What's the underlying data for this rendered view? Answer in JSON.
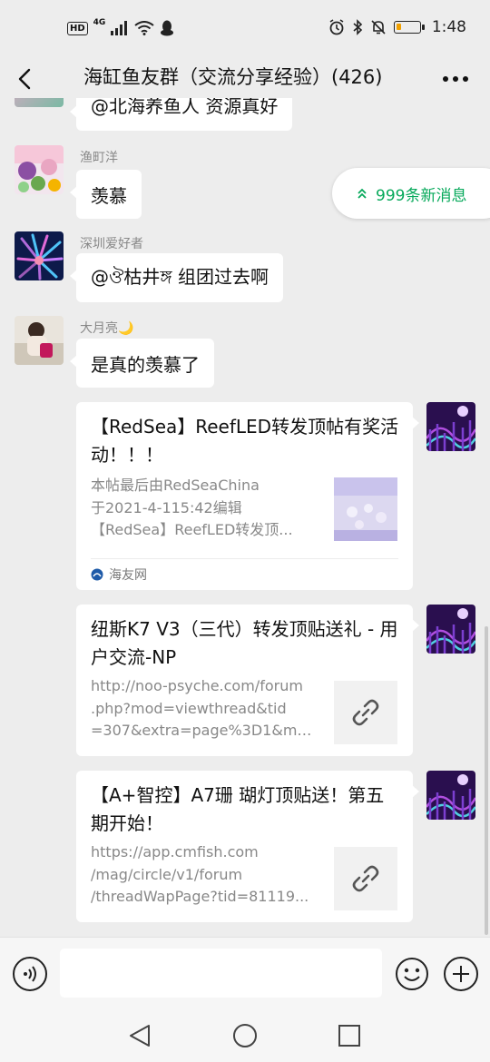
{
  "status_bar": {
    "hd": "HD",
    "network": "4G",
    "time": "1:48",
    "battery_level": 0.2
  },
  "header": {
    "title": "海缸鱼友群（交流分享经验）(426)"
  },
  "messages": {
    "partial_text": "@北海养鱼人 资源真好",
    "items": [
      {
        "sender": "渔町洋",
        "text": "羡慕"
      },
      {
        "sender": "深圳爱好者",
        "text": "@ঔ枯井ঙ্গ 组团过去啊"
      },
      {
        "sender": "大月亮🌙",
        "text": "是真的羡慕了"
      }
    ],
    "new_messages_label": "999条新消息"
  },
  "link_cards": [
    {
      "title": "【RedSea】ReefLED转发顶帖有奖活动！！！",
      "desc_lines": [
        "本帖最后由RedSeaChina",
        "于2021-4-115:42编辑",
        "【RedSea】ReefLED转发顶..."
      ],
      "source": "海友网",
      "thumb": "image"
    },
    {
      "title": "纽斯K7 V3（三代）转发顶贴送礼 - 用户交流-NP",
      "desc_lines": [
        "http://noo-psyche.com/forum",
        ".php?mod=viewthread&tid",
        "=307&extra=page%3D1&mo..."
      ],
      "thumb": "link-icon"
    },
    {
      "title": "【A+智控】A7珊 瑚灯顶贴送！第五期开始！",
      "desc_lines": [
        "https://app.cmfish.com",
        "/mag/circle/v1/forum",
        "/threadWapPage?tid=81119..."
      ],
      "thumb": "link-icon"
    }
  ],
  "input_bar": {
    "voice_icon": "voice-icon",
    "emoji_icon": "emoji-icon",
    "plus_icon": "plus-icon",
    "value": ""
  },
  "colors": {
    "accent_green": "#07a95b",
    "background": "#ededed"
  }
}
